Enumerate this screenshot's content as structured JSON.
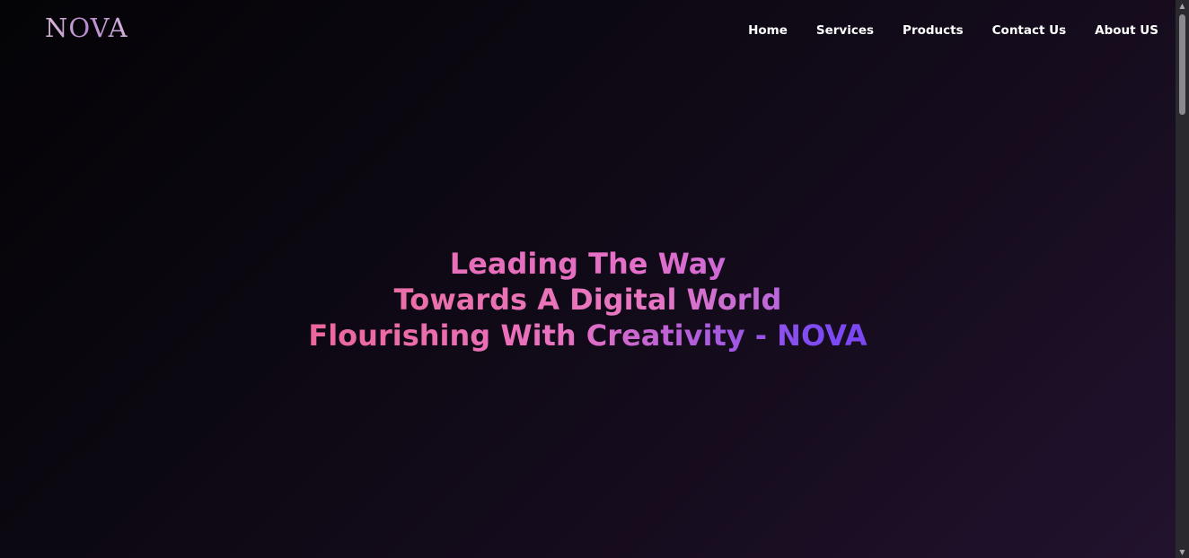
{
  "brand": {
    "logo_text": "NOVA"
  },
  "nav": {
    "items": [
      {
        "label": "Home"
      },
      {
        "label": "Services"
      },
      {
        "label": "Products"
      },
      {
        "label": "Contact Us"
      },
      {
        "label": "About US"
      }
    ]
  },
  "hero": {
    "lines": [
      "Leading The Way",
      "Towards A Digital World",
      "Flourishing With Creativity - NOVA"
    ]
  },
  "colors": {
    "background_dark": "#040306",
    "background_purple": "#22122e",
    "gradient_pink": "#f06d8d",
    "gradient_magenta": "#e36fc9",
    "gradient_violet": "#6b3ff3"
  },
  "icons": {
    "scroll_up": "triangle-up-icon",
    "scroll_down": "triangle-down-icon"
  }
}
